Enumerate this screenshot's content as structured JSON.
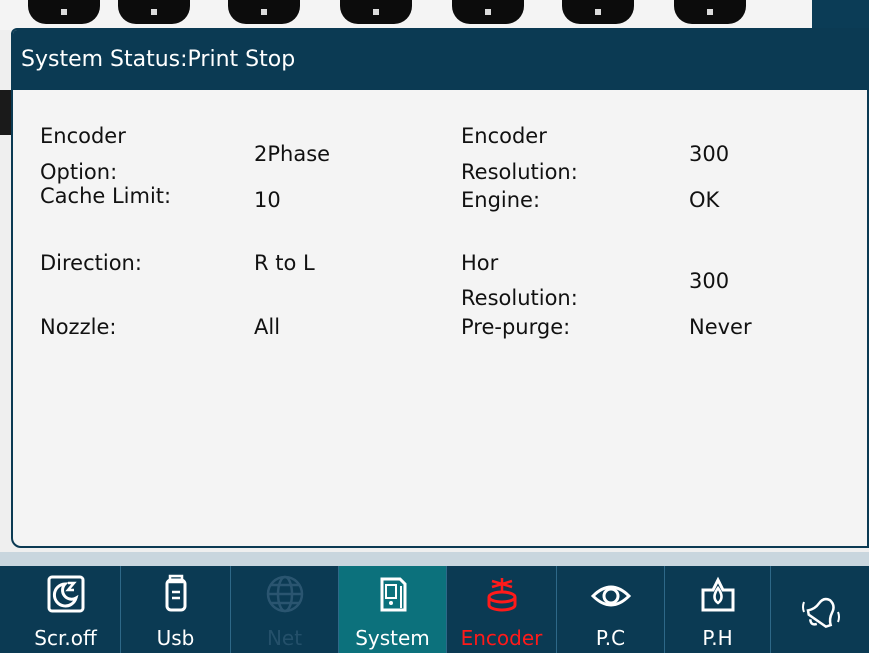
{
  "dialog": {
    "title": "System Status:Print Stop"
  },
  "status": {
    "encoder_option_label_1": "Encoder",
    "encoder_option_label_2": "Option:",
    "encoder_option_value": "2Phase",
    "encoder_resolution_label_1": "Encoder",
    "encoder_resolution_label_2": "Resolution:",
    "encoder_resolution_value": "300",
    "cache_limit_label": "Cache Limit:",
    "cache_limit_value": "10",
    "engine_label": "Engine:",
    "engine_value": "OK",
    "direction_label": "Direction:",
    "direction_value": "R to L",
    "hor_resolution_label_1": "Hor",
    "hor_resolution_label_2": "Resolution:",
    "hor_resolution_value": "300",
    "nozzle_label": "Nozzle:",
    "nozzle_value": "All",
    "pre_purge_label": "Pre-purge:",
    "pre_purge_value": "Never"
  },
  "toolbar": {
    "buttons": [
      {
        "label": "Scr.off",
        "icon": "screen-off-moon-icon",
        "state": "normal"
      },
      {
        "label": "Usb",
        "icon": "usb-drive-icon",
        "state": "normal"
      },
      {
        "label": "Net",
        "icon": "globe-network-icon",
        "state": "disabled"
      },
      {
        "label": "System",
        "icon": "printer-system-icon",
        "state": "active"
      },
      {
        "label": "Encoder",
        "icon": "encoder-wheel-icon",
        "state": "alert"
      },
      {
        "label": "P.C",
        "icon": "eye-photocell-icon",
        "state": "normal"
      },
      {
        "label": "P.H",
        "icon": "ink-drop-printhead-icon",
        "state": "normal"
      }
    ],
    "bell_icon": "ringing-bell-icon"
  },
  "colors": {
    "header_bg": "#0b3a53",
    "active_tab_bg": "#0c717c",
    "alert_red": "#ff1a1a",
    "disabled_text": "#24506a",
    "dialog_bg": "#f4f4f4"
  }
}
